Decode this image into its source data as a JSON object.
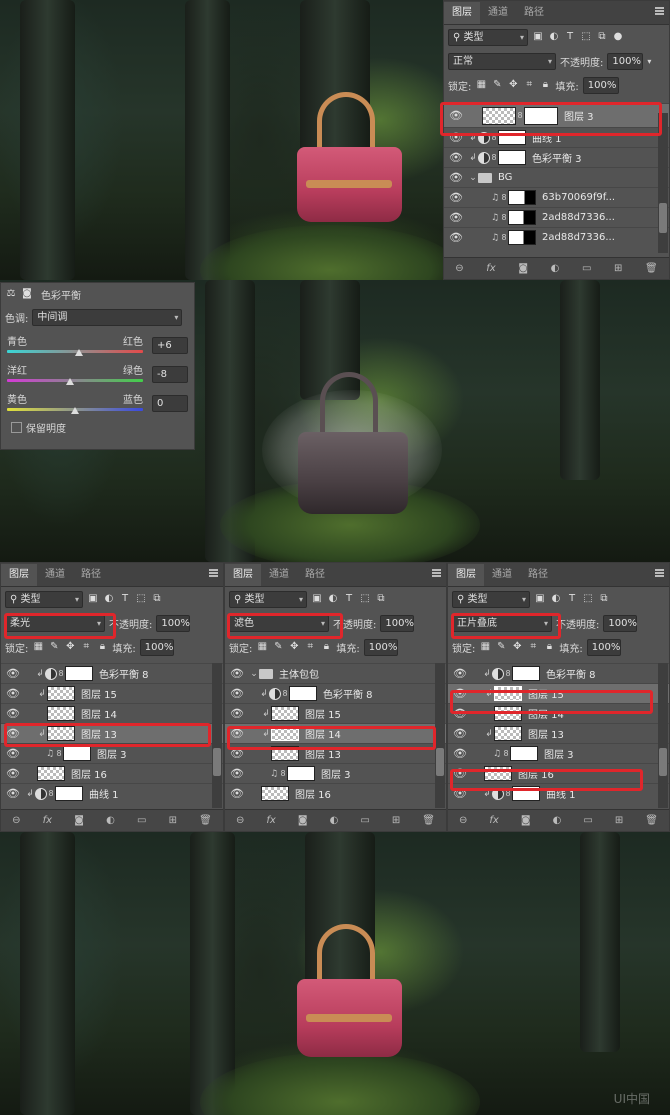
{
  "layers_panel_top": {
    "tabs": [
      "图层",
      "通道",
      "路径"
    ],
    "filter_label": "类型",
    "blend_mode": "正常",
    "opacity_label": "不透明度:",
    "opacity_value": "100%",
    "lock_label": "锁定:",
    "fill_label": "填充:",
    "fill_value": "100%",
    "layers": [
      {
        "name": "图层 3",
        "selected": true
      },
      {
        "name": "曲线 1"
      },
      {
        "name": "色彩平衡 3"
      },
      {
        "name": "BG"
      },
      {
        "name": "63b70069f9f..."
      },
      {
        "name": "2ad88d7336..."
      },
      {
        "name": "2ad88d7336..."
      }
    ]
  },
  "color_balance": {
    "title": "色彩平衡",
    "tone_label": "色调:",
    "tone_value": "中间调",
    "sliders": [
      {
        "left": "青色",
        "right": "红色",
        "value": "+6"
      },
      {
        "left": "洋红",
        "right": "绿色",
        "value": "-8"
      },
      {
        "left": "黄色",
        "right": "蓝色",
        "value": "0"
      }
    ],
    "preserve_label": "保留明度"
  },
  "panel_a": {
    "tabs": [
      "图层",
      "通道",
      "路径"
    ],
    "filter_label": "类型",
    "blend_mode": "柔光",
    "opacity_label": "不透明度:",
    "opacity_value": "100%",
    "lock_label": "锁定:",
    "fill_label": "填充:",
    "fill_value": "100%",
    "layers": [
      {
        "name": "色彩平衡 8"
      },
      {
        "name": "图层 15"
      },
      {
        "name": "图层 14"
      },
      {
        "name": "图层 13"
      },
      {
        "name": "图层 3"
      },
      {
        "name": "图层 16"
      },
      {
        "name": "曲线 1"
      }
    ]
  },
  "panel_b": {
    "tabs": [
      "图层",
      "通道",
      "路径"
    ],
    "filter_label": "类型",
    "blend_mode": "滤色",
    "opacity_label": "不透明度:",
    "opacity_value": "100%",
    "lock_label": "锁定:",
    "fill_label": "填充:",
    "fill_value": "100%",
    "layers": [
      {
        "name": "主体包包"
      },
      {
        "name": "色彩平衡 8"
      },
      {
        "name": "图层 15"
      },
      {
        "name": "图层 14"
      },
      {
        "name": "图层 13"
      },
      {
        "name": "图层 3"
      },
      {
        "name": "图层 16"
      }
    ]
  },
  "panel_c": {
    "tabs": [
      "图层",
      "通道",
      "路径"
    ],
    "filter_label": "类型",
    "blend_mode": "正片叠底",
    "opacity_label": "不透明度:",
    "opacity_value": "100%",
    "lock_label": "锁定:",
    "fill_label": "填充:",
    "fill_value": "100%",
    "layers": [
      {
        "name": "色彩平衡 8"
      },
      {
        "name": "图层 15"
      },
      {
        "name": "图层 14"
      },
      {
        "name": "图层 13"
      },
      {
        "name": "图层 3"
      },
      {
        "name": "图层 16"
      },
      {
        "name": "曲线 1"
      }
    ]
  },
  "watermark": "UI中国",
  "colors": {
    "panel_bg": "#535353",
    "highlight": "#e0262b",
    "bag_pink": "#c8486a",
    "bag_grey": "#504548"
  }
}
